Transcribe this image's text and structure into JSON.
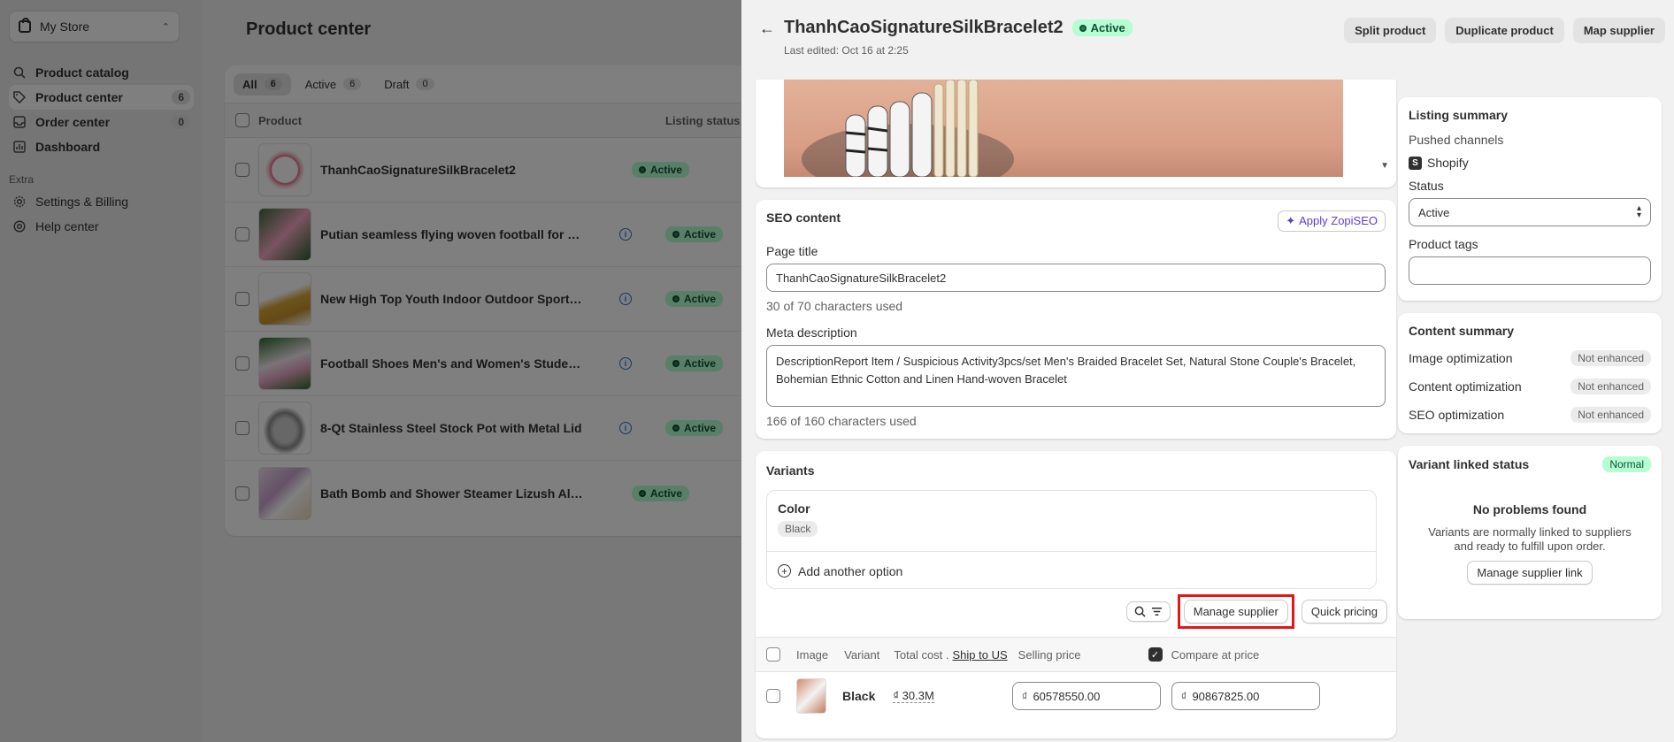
{
  "sidebar": {
    "store_name": "My Store",
    "items": [
      {
        "label": "Product catalog",
        "count": ""
      },
      {
        "label": "Product center",
        "count": "6"
      },
      {
        "label": "Order center",
        "count": "0"
      },
      {
        "label": "Dashboard",
        "count": ""
      }
    ],
    "section_label": "Extra",
    "extra_items": [
      {
        "label": "Settings & Billing"
      },
      {
        "label": "Help center"
      }
    ]
  },
  "main": {
    "title": "Product center",
    "tabs": [
      {
        "label": "All",
        "count": "6"
      },
      {
        "label": "Active",
        "count": "6"
      },
      {
        "label": "Draft",
        "count": "0"
      }
    ],
    "columns": {
      "product": "Product",
      "listing_status": "Listing status"
    },
    "rows": [
      {
        "name": "ThanhCaoSignatureSilkBracelet2",
        "status": "Active"
      },
      {
        "name": "Putian seamless flying woven football for mal...",
        "status": "Active"
      },
      {
        "name": "New High Top Youth Indoor Outdoor Sports w...",
        "status": "Active"
      },
      {
        "name": "Football Shoes Men's and Women's Students...",
        "status": "Active"
      },
      {
        "name": "8-Qt Stainless Steel Stock Pot with Metal Lid",
        "status": "Active"
      },
      {
        "name": "Bath Bomb and Shower Steamer Lizush All N...",
        "status": "Active"
      }
    ]
  },
  "panel": {
    "title": "ThanhCaoSignatureSilkBracelet2",
    "status": "Active",
    "last_edited": "Last edited: Oct 16 at 2:25",
    "actions": {
      "split": "Split product",
      "duplicate": "Duplicate product",
      "map": "Map supplier"
    },
    "seo": {
      "heading": "SEO content",
      "apply_btn": "Apply ZopiSEO",
      "page_title_label": "Page title",
      "page_title_value": "ThanhCaoSignatureSilkBracelet2",
      "page_title_count": "30 of 70 characters used",
      "meta_label": "Meta description",
      "meta_value": "DescriptionReport Item / Suspicious Activity3pcs/set Men's Braided Bracelet Set, Natural Stone Couple's Bracelet, Bohemian Ethnic Cotton and Linen Hand-woven Bracelet",
      "meta_count": "166 of 160 characters used"
    },
    "variants": {
      "heading": "Variants",
      "option_name": "Color",
      "option_value": "Black",
      "add_option": "Add another option",
      "manage_supplier": "Manage supplier",
      "quick_pricing": "Quick pricing",
      "col_image": "Image",
      "col_variant": "Variant",
      "col_total_cost": "Total cost .",
      "col_ship_to": "Ship to US",
      "col_selling_price": "Selling price",
      "col_compare": "Compare at price",
      "row": {
        "name": "Black",
        "cost": "₫ 30.3M",
        "currency": "₫",
        "selling": "60578550.00",
        "compare": "90867825.00"
      }
    },
    "listing_summary": {
      "heading": "Listing summary",
      "pushed_label": "Pushed channels",
      "channel": "Shopify",
      "status_label": "Status",
      "status_value": "Active",
      "tags_label": "Product tags"
    },
    "content_summary": {
      "heading": "Content summary",
      "rows": [
        {
          "label": "Image optimization",
          "badge": "Not enhanced"
        },
        {
          "label": "Content optimization",
          "badge": "Not enhanced"
        },
        {
          "label": "SEO optimization",
          "badge": "Not enhanced"
        }
      ]
    },
    "variant_link": {
      "heading": "Variant linked status",
      "badge": "Normal",
      "title": "No problems found",
      "desc": "Variants are normally linked to suppliers and ready to fulfill upon order.",
      "button": "Manage supplier link"
    }
  }
}
